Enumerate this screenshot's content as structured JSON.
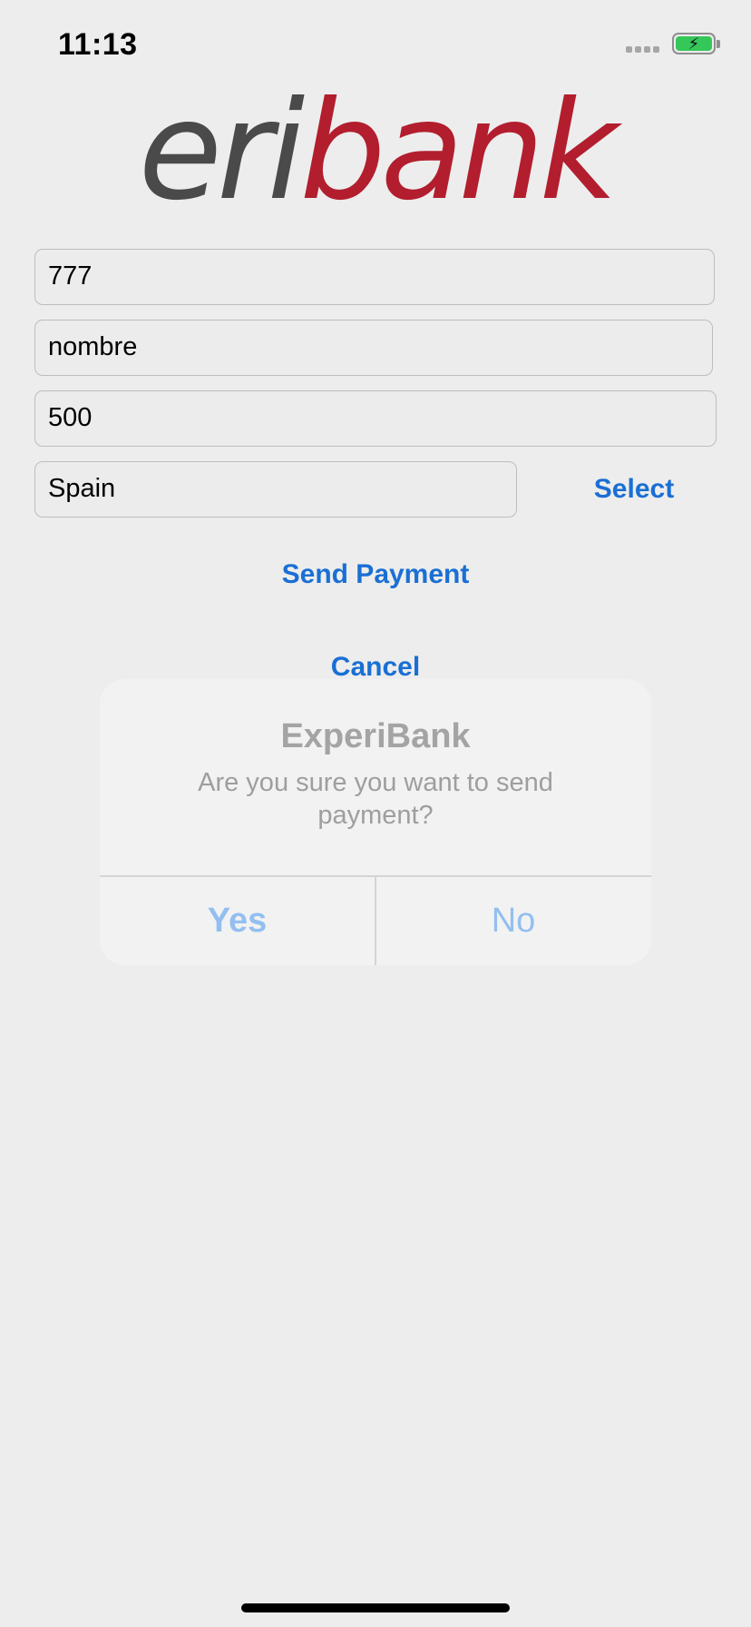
{
  "status_bar": {
    "time": "11:13",
    "battery_icon": "charging-battery-icon",
    "signal_icon": "signal-dots-icon",
    "battery_color": "#35c759"
  },
  "logo": {
    "part1": "eri",
    "part2": "bank",
    "colors": {
      "part1": "#4a4a4a",
      "part2": "#b21e2e"
    }
  },
  "form": {
    "field1_value": "777",
    "field2_value": "nombre",
    "field3_value": "500",
    "country_value": "Spain",
    "select_label": "Select",
    "send_payment_label": "Send Payment",
    "cancel_label": "Cancel"
  },
  "alert": {
    "title": "ExperiBank",
    "message": "Are you sure you want to send payment?",
    "yes_label": "Yes",
    "no_label": "No"
  },
  "colors": {
    "accent": "#1a6fd4",
    "background": "#ededed"
  }
}
